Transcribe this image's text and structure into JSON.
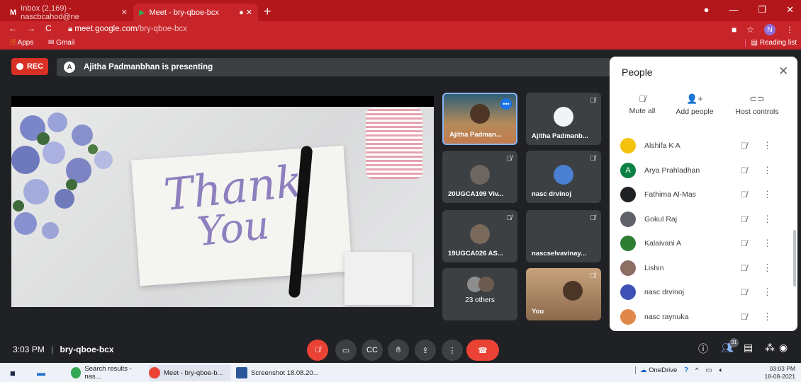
{
  "browser": {
    "tabs": [
      {
        "label": "Inbox (2,169) - nascbcahod@ne"
      },
      {
        "label": "Meet - bry-qboe-bcx"
      }
    ],
    "url_host": "meet.google.com",
    "url_path": "/bry-qboe-bcx",
    "bookmarks": {
      "apps": "Apps",
      "gmail": "Gmail",
      "reading_list": "Reading list"
    },
    "profile_initial": "N"
  },
  "meet": {
    "rec_label": "REC",
    "presenting_text": "Ajitha Padmanbhan is presenting",
    "slide_text": [
      "Thank",
      "You"
    ],
    "tiles": [
      {
        "name": "Ajitha Padman..."
      },
      {
        "name": "Ajitha Padmanb..."
      },
      {
        "name": "20UGCA109 Viv..."
      },
      {
        "name": "nasc drvinoj"
      },
      {
        "name": "19UGCA026 AS..."
      },
      {
        "name": "nascselvavinay..."
      },
      {
        "name": "23 others"
      },
      {
        "name": "You"
      }
    ],
    "time": "3:03 PM",
    "meeting_code": "bry-qboe-bcx",
    "participants_badge": "31"
  },
  "people": {
    "title": "People",
    "actions": [
      {
        "label": "Mute all",
        "icon": "mic-off-icon"
      },
      {
        "label": "Add people",
        "icon": "add-person-icon"
      },
      {
        "label": "Host controls",
        "icon": "toggle-icon"
      }
    ],
    "list": [
      {
        "name": "Alshifa K A",
        "color": "#f4c20d",
        "initial": ""
      },
      {
        "name": "Arya Prahladhan",
        "color": "#0b8043",
        "initial": "A"
      },
      {
        "name": "Fathima Al-Mas",
        "color": "#202124",
        "initial": ""
      },
      {
        "name": "Gokul Raj",
        "color": "#5f6368",
        "initial": ""
      },
      {
        "name": "Kalaivani A",
        "color": "#2e7d32",
        "initial": ""
      },
      {
        "name": "Lishin",
        "color": "#8d6e63",
        "initial": ""
      },
      {
        "name": "nasc drvinoj",
        "color": "#3f51b5",
        "initial": ""
      },
      {
        "name": "nasc raynuka",
        "color": "#e0884a",
        "initial": ""
      }
    ]
  },
  "taskbar": {
    "items": [
      {
        "label": "Search results - nas..."
      },
      {
        "label": "Meet - bry-qboe-b..."
      },
      {
        "label": "Screenshot 18.08.20..."
      }
    ],
    "onedrive": "OneDrive",
    "clock_time": "03:03 PM",
    "clock_date": "18-08-2021"
  }
}
